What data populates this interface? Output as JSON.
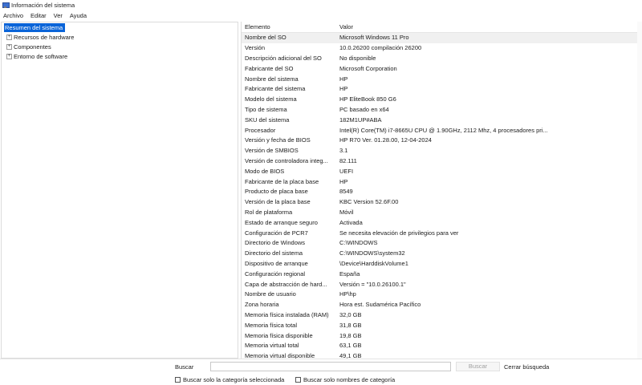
{
  "window": {
    "title": "Información del sistema"
  },
  "menu": [
    "Archivo",
    "Editar",
    "Ver",
    "Ayuda"
  ],
  "tree": {
    "root": "Resumen del sistema",
    "children": [
      {
        "label": "Recursos de hardware",
        "expander": "+"
      },
      {
        "label": "Componentes",
        "expander": "+"
      },
      {
        "label": "Entorno de software",
        "expander": "+"
      }
    ]
  },
  "list": {
    "headers": {
      "item": "Elemento",
      "value": "Valor"
    },
    "rows": [
      {
        "item": "Nombre del SO",
        "value": "Microsoft Windows 11 Pro"
      },
      {
        "item": "Versión",
        "value": "10.0.26200 compilación 26200"
      },
      {
        "item": "Descripción adicional del SO",
        "value": "No disponible"
      },
      {
        "item": "Fabricante del SO",
        "value": "Microsoft Corporation"
      },
      {
        "item": "Nombre del sistema",
        "value": "HP"
      },
      {
        "item": "Fabricante del sistema",
        "value": "HP"
      },
      {
        "item": "Modelo del sistema",
        "value": "HP EliteBook 850 G6"
      },
      {
        "item": "Tipo de sistema",
        "value": "PC basado en x64"
      },
      {
        "item": "SKU del sistema",
        "value": "182M1UP#ABA"
      },
      {
        "item": "Procesador",
        "value": "Intel(R) Core(TM) i7-8665U CPU @ 1.90GHz, 2112 Mhz, 4 procesadores pri..."
      },
      {
        "item": "Versión y fecha de BIOS",
        "value": "HP R70 Ver. 01.28.00, 12-04-2024"
      },
      {
        "item": "Versión de SMBIOS",
        "value": "3.1"
      },
      {
        "item": "Versión de controladora integ...",
        "value": "82.111"
      },
      {
        "item": "Modo de BIOS",
        "value": "UEFI"
      },
      {
        "item": "Fabricante de la placa base",
        "value": "HP"
      },
      {
        "item": "Producto de placa base",
        "value": "8549"
      },
      {
        "item": "Versión de la placa base",
        "value": "KBC Version 52.6F.00"
      },
      {
        "item": "Rol de plataforma",
        "value": "Móvil"
      },
      {
        "item": "Estado de arranque seguro",
        "value": "Activada"
      },
      {
        "item": "Configuración de PCR7",
        "value": "Se necesita elevación de privilegios para ver"
      },
      {
        "item": "Directorio de Windows",
        "value": "C:\\WINDOWS"
      },
      {
        "item": "Directorio del sistema",
        "value": "C:\\WINDOWS\\system32"
      },
      {
        "item": "Dispositivo de arranque",
        "value": "\\Device\\HarddiskVolume1"
      },
      {
        "item": "Configuración regional",
        "value": "España"
      },
      {
        "item": "Capa de abstracción de hard...",
        "value": "Versión = \"10.0.26100.1\""
      },
      {
        "item": "Nombre de usuario",
        "value": "HP\\hp"
      },
      {
        "item": "Zona horaria",
        "value": "Hora est. Sudamérica Pacífico"
      },
      {
        "item": "Memoria física instalada (RAM)",
        "value": "32,0 GB"
      },
      {
        "item": "Memoria física total",
        "value": "31,8 GB"
      },
      {
        "item": "Memoria física disponible",
        "value": "19,8 GB"
      },
      {
        "item": "Memoria virtual total",
        "value": "63,1 GB"
      },
      {
        "item": "Memoria virtual disponible",
        "value": "49,1 GB"
      }
    ]
  },
  "search": {
    "label": "Buscar",
    "value": "",
    "button": "Buscar",
    "close": "Cerrar búsqueda",
    "check_selected": "Buscar solo la categoría seleccionada",
    "check_names": "Buscar solo nombres de categoría"
  },
  "colors": {
    "selection": "#0a64d8"
  }
}
